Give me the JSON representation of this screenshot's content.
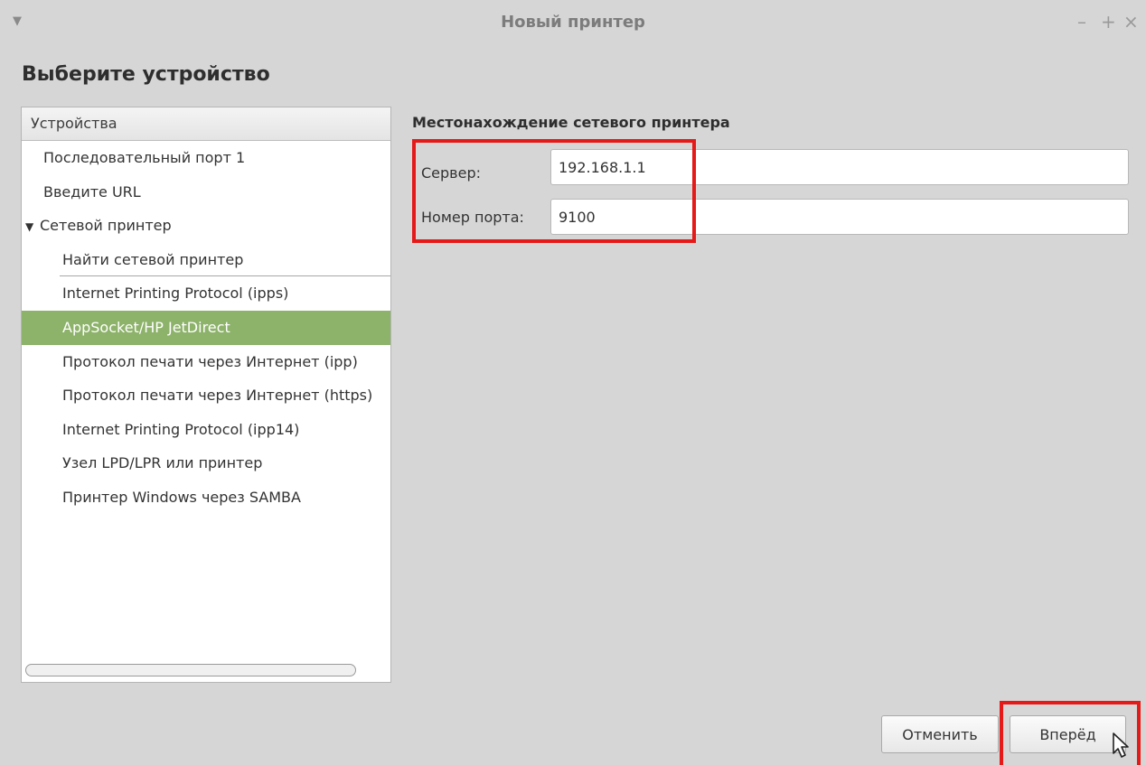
{
  "window": {
    "title": "Новый принтер",
    "menu_glyph": "▼",
    "controls": {
      "minimize": "–",
      "maximize": "+",
      "close": "×"
    }
  },
  "page": {
    "title": "Выберите устройство"
  },
  "devices": {
    "header": "Устройства",
    "items": [
      {
        "label": "Последовательный порт 1",
        "level": 0
      },
      {
        "label": "Введите URL",
        "level": 0
      },
      {
        "label": "Сетевой принтер",
        "level": 0,
        "expanded": true,
        "expander": "▼"
      },
      {
        "label": "Найти сетевой принтер",
        "level": 1
      },
      {
        "label": "Internet Printing Protocol (ipps)",
        "level": 1
      },
      {
        "label": "AppSocket/HP JetDirect",
        "level": 1,
        "selected": true
      },
      {
        "label": "Протокол печати через Интернет (ipp)",
        "level": 1
      },
      {
        "label": "Протокол печати через Интернет (https)",
        "level": 1
      },
      {
        "label": "Internet Printing Protocol (ipp14)",
        "level": 1
      },
      {
        "label": "Узел LPD/LPR или принтер",
        "level": 1
      },
      {
        "label": "Принтер Windows через SAMBA",
        "level": 1
      }
    ]
  },
  "location": {
    "title": "Местонахождение сетевого принтера",
    "server_label": "Сервер:",
    "server_value": "192.168.1.1",
    "port_label": "Номер порта:",
    "port_value": "9100"
  },
  "buttons": {
    "cancel": "Отменить",
    "next": "Вперёд"
  },
  "colors": {
    "selection": "#8db26a",
    "highlight": "#e61919",
    "background": "#d6d6d6"
  }
}
